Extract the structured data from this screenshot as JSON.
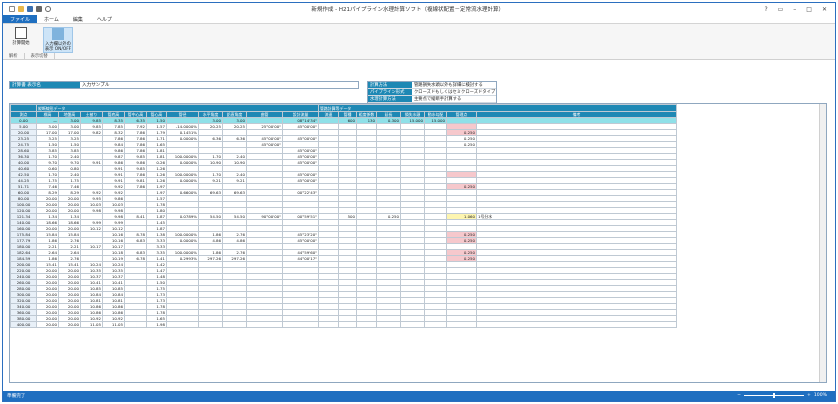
{
  "window": {
    "title": "新規作成 - H21パイプライン水理計算ソフト（複線状配置－定常流水理計算）",
    "controls": [
      "?",
      "▭",
      "–",
      "□",
      "✕"
    ]
  },
  "menu": {
    "file": "ファイル",
    "items": [
      "ホーム",
      "編集",
      "ヘルプ"
    ]
  },
  "ribbon": {
    "buttons": [
      {
        "label": "計算開始",
        "icon": "calculator-icon"
      },
      {
        "label": "入力欄以外の表示 ON/OFF",
        "icon": "toggle-display-icon"
      }
    ],
    "groups": [
      "解析",
      "表示切替"
    ]
  },
  "calc_name": {
    "label": "計算書 表示名",
    "value": "入力サンプル"
  },
  "info": [
    {
      "key": "計算方法",
      "value": "管路損失水頭以外も詳細に検討する"
    },
    {
      "key": "パイプライン形式",
      "value": "クローズドもしくはセミクローズドタイプ"
    },
    {
      "key": "水理計算方法",
      "value": "主要点で縦断手計算する"
    }
  ],
  "grid": {
    "section_left": "縦断線形データ",
    "section_right": "管路計算等データ",
    "headers": [
      "測点",
      "標高",
      "地盤高",
      "土被り",
      "管底高",
      "管中心高",
      "管心高",
      "管径",
      "水平角度",
      "鉛直角度",
      "曲管",
      "設計流量",
      "流速",
      "管種",
      "粗度係数",
      "延長",
      "損失水頭",
      "動水勾配",
      "管理点",
      "備考"
    ],
    "subheaders": [
      "GL",
      "管底",
      "管心",
      "水平",
      "鉛直",
      "合成",
      "度",
      "分",
      "秒"
    ],
    "rows": [
      [
        "0.00",
        "—",
        "3.00",
        "9.85",
        "8.35",
        "6.35",
        "1.50",
        "",
        "3.00",
        "3.00",
        "",
        "08°14'34\"",
        "",
        "600",
        "130",
        "0.300",
        "15.000",
        "15.000",
        "",
        "sel"
      ],
      [
        "5.00",
        "3.00",
        "3.00",
        "9.85",
        "7.85",
        "7.92",
        "1.57",
        "-14.0000%",
        "20.25",
        "20.25",
        "25°00'00\"",
        "45°00'00\"",
        "",
        "",
        "",
        "",
        "",
        "",
        "",
        "pink"
      ],
      [
        "20.00",
        "17.00",
        "17.00",
        "9.82",
        "8.32",
        "7.86",
        "1.79",
        "0.1451%",
        "",
        "",
        "",
        "",
        "",
        "",
        "",
        "",
        "",
        "",
        "0.250",
        "pink"
      ],
      [
        "23.25",
        "3.25",
        "3.25",
        "",
        "7.86",
        "7.86",
        "1.71",
        "0.0000%",
        "6.36",
        "6.36",
        "45°00'00\"",
        "45°00'00\"",
        "",
        "",
        "",
        "",
        "",
        "",
        "0.250",
        ""
      ],
      [
        "24.75",
        "1.50",
        "1.50",
        "",
        "9.84",
        "7.86",
        "1.65",
        "",
        "",
        "",
        "45°00'00\"",
        "",
        "",
        "",
        "",
        "",
        "",
        "",
        "0.250",
        ""
      ],
      [
        "28.60",
        "3.85",
        "3.85",
        "",
        "9.86",
        "7.86",
        "1.81",
        "",
        "",
        "",
        "",
        "45°00'00\"",
        "",
        "",
        "",
        "",
        "",
        "",
        "",
        ""
      ],
      [
        "36.30",
        "1.70",
        "2.40",
        "",
        "9.87",
        "9.85",
        "1.81",
        "100.0000%",
        "1.70",
        "2.40",
        "",
        "45°00'00\"",
        "",
        "",
        "",
        "",
        "",
        "",
        "",
        ""
      ],
      [
        "40.00",
        "9.70",
        "9.70",
        "9.91",
        "9.86",
        "9.86",
        "0.26",
        "0.0000%",
        "10.90",
        "10.90",
        "",
        "45°00'00\"",
        "",
        "",
        "",
        "",
        "",
        "",
        "",
        ""
      ],
      [
        "40.60",
        "0.60",
        "0.80",
        "",
        "9.91",
        "9.85",
        "1.26",
        "",
        "",
        "",
        "",
        "",
        "",
        "",
        "",
        "",
        "",
        "",
        "",
        ""
      ],
      [
        "42.50",
        "1.70",
        "2.40",
        "",
        "9.91",
        "7.86",
        "1.26",
        "100.0000%",
        "1.70",
        "2.40",
        "",
        "45°00'00\"",
        "",
        "",
        "",
        "",
        "",
        "",
        "",
        "pink"
      ],
      [
        "44.25",
        "1.75",
        "1.75",
        "",
        "9.91",
        "9.81",
        "1.26",
        "0.0000%",
        "9.21",
        "9.21",
        "",
        "45°00'00\"",
        "",
        "",
        "",
        "",
        "",
        "",
        "",
        ""
      ],
      [
        "51.71",
        "7.46",
        "7.46",
        "",
        "9.92",
        "7.86",
        "1.97",
        "",
        "",
        "",
        "",
        "",
        "",
        "",
        "",
        "",
        "",
        "",
        "0.250",
        "pink"
      ],
      [
        "60.00",
        "8.29",
        "8.29",
        "9.92",
        "9.92",
        "",
        "1.97",
        "0.6600%",
        "69.63",
        "69.63",
        "",
        "00°22'43\"",
        "",
        "",
        "",
        "",
        "",
        "",
        "",
        ""
      ],
      [
        "80.00",
        "20.00",
        "20.00",
        "9.95",
        "9.86",
        "",
        "1.57",
        "",
        "",
        "",
        "",
        "",
        "",
        "",
        "",
        "",
        "",
        "",
        "",
        ""
      ],
      [
        "100.00",
        "20.00",
        "20.00",
        "10.03",
        "10.03",
        "",
        "1.78",
        "",
        "",
        "",
        "",
        "",
        "",
        "",
        "",
        "",
        "",
        "",
        "",
        ""
      ],
      [
        "120.00",
        "20.00",
        "20.00",
        "9.98",
        "9.98",
        "",
        "1.80",
        "",
        "",
        "",
        "",
        "",
        "",
        "",
        "",
        "",
        "",
        "",
        "",
        ""
      ],
      [
        "121.34",
        "1.34",
        "1.34",
        "",
        "9.98",
        "8.41",
        "1.87",
        "0.0789%",
        "54.50",
        "54.50",
        "90°00'00\"",
        "00°59'51\"",
        "",
        "500",
        "",
        "0.250",
        "",
        "",
        "1.060",
        "yel"
      ],
      [
        "140.00",
        "18.66",
        "18.66",
        "9.99",
        "9.99",
        "",
        "1.45",
        "",
        "",
        "",
        "",
        "",
        "",
        "",
        "",
        "",
        "",
        "",
        "",
        ""
      ],
      [
        "160.00",
        "20.00",
        "20.00",
        "10.12",
        "10.12",
        "",
        "1.87",
        "",
        "",
        "",
        "",
        "",
        "",
        "",
        "",
        "",
        "",
        "",
        "",
        ""
      ],
      [
        "175.84",
        "15.84",
        "15.84",
        "",
        "10.16",
        "8.78",
        "1.38",
        "100.0000%",
        "1.86",
        "2.76",
        "",
        "45°23'20\"",
        "",
        "",
        "",
        "",
        "",
        "",
        "0.250",
        "pink"
      ],
      [
        "177.79",
        "1.86",
        "2.76",
        "",
        "10.16",
        "6.83",
        "3.33",
        "0.0000%",
        "4.86",
        "4.86",
        "",
        "45°00'00\"",
        "",
        "",
        "",
        "",
        "",
        "",
        "0.250",
        "pink"
      ],
      [
        "180.00",
        "2.21",
        "2.21",
        "10.17",
        "10.17",
        "",
        "3.33",
        "",
        "",
        "",
        "",
        "",
        "",
        "",
        "",
        "",
        "",
        "",
        "",
        ""
      ],
      [
        "182.64",
        "2.64",
        "2.64",
        "",
        "10.18",
        "6.83",
        "3.35",
        "100.0000%",
        "1.86",
        "2.76",
        "",
        "44°59'60\"",
        "",
        "",
        "",
        "",
        "",
        "",
        "0.250",
        "pink"
      ],
      [
        "184.59",
        "1.86",
        "2.76",
        "",
        "10.19",
        "6.78",
        "1.41",
        "0.2993%",
        "297.26",
        "297.26",
        "",
        "44°00'17\"",
        "",
        "",
        "",
        "",
        "",
        "",
        "0.250",
        "pink"
      ],
      [
        "200.00",
        "15.41",
        "15.41",
        "10.24",
        "10.24",
        "",
        "1.42",
        "",
        "",
        "",
        "",
        "",
        "",
        "",
        "",
        "",
        "",
        "",
        "",
        ""
      ],
      [
        "220.00",
        "20.00",
        "20.00",
        "10.35",
        "10.35",
        "",
        "1.47",
        "",
        "",
        "",
        "",
        "",
        "",
        "",
        "",
        "",
        "",
        "",
        "",
        ""
      ],
      [
        "240.00",
        "20.00",
        "20.00",
        "10.37",
        "10.37",
        "",
        "1.48",
        "",
        "",
        "",
        "",
        "",
        "",
        "",
        "",
        "",
        "",
        "",
        "",
        ""
      ],
      [
        "260.00",
        "20.00",
        "20.00",
        "10.41",
        "10.41",
        "",
        "1.50",
        "",
        "",
        "",
        "",
        "",
        "",
        "",
        "",
        "",
        "",
        "",
        "",
        ""
      ],
      [
        "280.00",
        "20.00",
        "20.00",
        "10.85",
        "10.85",
        "",
        "1.75",
        "",
        "",
        "",
        "",
        "",
        "",
        "",
        "",
        "",
        "",
        "",
        "",
        ""
      ],
      [
        "300.00",
        "20.00",
        "20.00",
        "10.84",
        "10.84",
        "",
        "1.73",
        "",
        "",
        "",
        "",
        "",
        "",
        "",
        "",
        "",
        "",
        "",
        "",
        ""
      ],
      [
        "320.00",
        "20.00",
        "20.00",
        "10.81",
        "10.81",
        "",
        "1.73",
        "",
        "",
        "",
        "",
        "",
        "",
        "",
        "",
        "",
        "",
        "",
        "",
        ""
      ],
      [
        "340.00",
        "20.00",
        "20.00",
        "10.86",
        "10.86",
        "",
        "1.78",
        "",
        "",
        "",
        "",
        "",
        "",
        "",
        "",
        "",
        "",
        "",
        "",
        ""
      ],
      [
        "360.00",
        "20.00",
        "20.00",
        "10.86",
        "10.86",
        "",
        "1.78",
        "",
        "",
        "",
        "",
        "",
        "",
        "",
        "",
        "",
        "",
        "",
        "",
        ""
      ],
      [
        "380.00",
        "20.00",
        "20.00",
        "10.92",
        "10.92",
        "",
        "1.65",
        "",
        "",
        "",
        "",
        "",
        "",
        "",
        "",
        "",
        "",
        "",
        "",
        ""
      ],
      [
        "400.00",
        "20.00",
        "20.00",
        "11.05",
        "11.05",
        "",
        "1.98",
        "",
        "",
        "",
        "",
        "",
        "",
        "",
        "",
        "",
        "",
        "",
        "",
        ""
      ]
    ],
    "memo": "1号分水"
  },
  "status": {
    "text": "準備完了",
    "zoom": "100%"
  },
  "colors": {
    "accent": "#1e88b4",
    "statusbar": "#1f6fc0",
    "pink": "#f6c8cc",
    "selected": "#8fe0e8"
  }
}
